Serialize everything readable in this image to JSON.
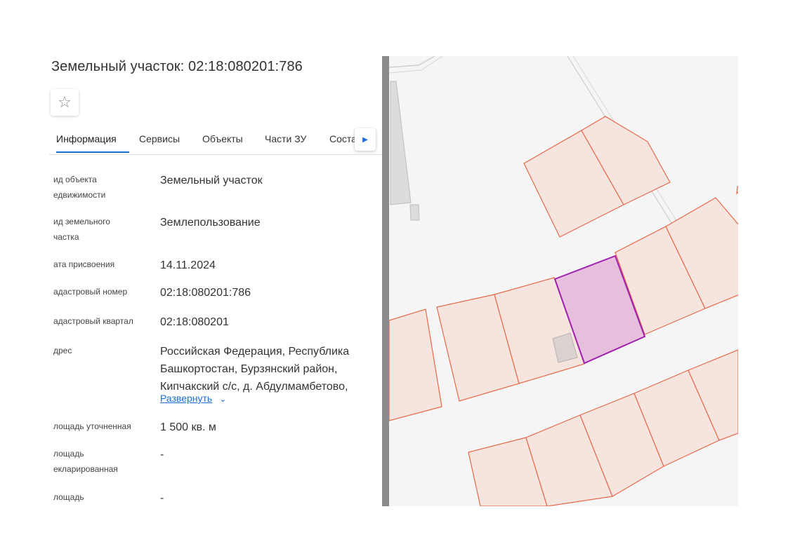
{
  "header": {
    "title": "Земельный участок: 02:18:080201:786"
  },
  "tabs": [
    {
      "label": "Информация",
      "active": true
    },
    {
      "label": "Сервисы",
      "active": false
    },
    {
      "label": "Объекты",
      "active": false
    },
    {
      "label": "Части ЗУ",
      "active": false
    },
    {
      "label": "Состав",
      "active": false
    }
  ],
  "info": {
    "object_type": {
      "label_line1": "ид объекта",
      "label_line2": "едвижимости",
      "value": "Земельный участок"
    },
    "land_type": {
      "label_line1": "ид земельного",
      "label_line2": "частка",
      "value": "Землепользование"
    },
    "assign_date": {
      "label": "ата присвоения",
      "value": "14.11.2024"
    },
    "cadastral_number": {
      "label": "адастровый номер",
      "value": "02:18:080201:786"
    },
    "cadastral_quarter": {
      "label": "адастровый квартал",
      "value": "02:18:080201"
    },
    "address": {
      "label": "дрес",
      "line1": "Российская Федерация, Республика",
      "line2": "Башкортостан, Бурзянский район,",
      "line3": "Кипчакский с/с, д. Абдулмамбетово,",
      "expand_label": "Развернуть"
    },
    "area_refined": {
      "label": "лощадь уточненная",
      "value": "1 500 кв. м"
    },
    "area_declared": {
      "label_line1": "лощадь",
      "label_line2": "екларированная",
      "value": "-"
    },
    "area": {
      "label": "лощадь",
      "value": "-"
    }
  },
  "icons": {
    "star": "star-outline-icon",
    "tab_scroll": "caret-right-icon",
    "expand": "chevron-down-icon"
  },
  "colors": {
    "accent": "#1b6fd6",
    "parcel_fill": "#f6e4de",
    "parcel_stroke": "#e8694a",
    "selected_fill": "#e5bfdc",
    "selected_stroke": "#a020b0",
    "divider": "#8a8a8a"
  }
}
